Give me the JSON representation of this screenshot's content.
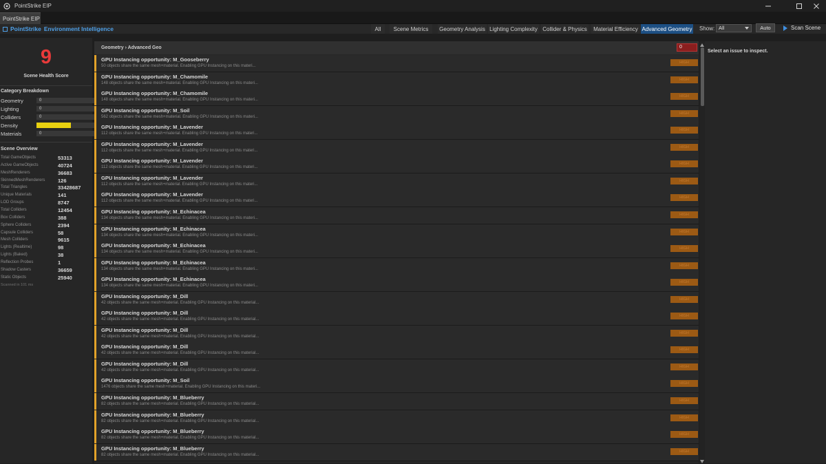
{
  "window": {
    "title": "PointStrike EIP"
  },
  "tab": {
    "label": "PointStrike EIP"
  },
  "brand": {
    "name": "PointStrike",
    "subtitle": "Environment Intelligence"
  },
  "nav": {
    "items": [
      "All",
      "Scene Metrics",
      "Geometry Analysis",
      "Lighting Complexity",
      "Collider & Physics",
      "Material Efficiency",
      "Advanced Geometry"
    ],
    "active": "Advanced Geometry",
    "show_label": "Show:",
    "show_value": "All",
    "auto_label": "Auto",
    "scan_label": "Scan Scene"
  },
  "health": {
    "score": "9",
    "label": "Scene Health Score",
    "score_color": "#e83a3a"
  },
  "category_breakdown": {
    "title": "Category Breakdown",
    "items": [
      {
        "label": "Geometry",
        "value": "0",
        "fill": 0
      },
      {
        "label": "Lighting",
        "value": "0",
        "fill": 0
      },
      {
        "label": "Colliders",
        "value": "0",
        "fill": 0
      },
      {
        "label": "Density",
        "value": "",
        "fill": 0.6
      },
      {
        "label": "Materials",
        "value": "0",
        "fill": 0
      }
    ],
    "fill_color": "#e8d010"
  },
  "overview": {
    "title": "Scene Overview",
    "rows": [
      {
        "k": "Total GameObjects",
        "v": "53313"
      },
      {
        "k": "Active GameObjects",
        "v": "40724"
      },
      {
        "k": "MeshRenderers",
        "v": "36683"
      },
      {
        "k": "SkinnedMeshRenderers",
        "v": "126"
      },
      {
        "k": "Total Triangles",
        "v": "33428687"
      },
      {
        "k": "Unique Materials",
        "v": "141"
      },
      {
        "k": "LOD Groups",
        "v": "8747"
      },
      {
        "k": "Total Colliders",
        "v": "12454"
      },
      {
        "k": "Box Colliders",
        "v": "388"
      },
      {
        "k": "Sphere Colliders",
        "v": "2394"
      },
      {
        "k": "Capsule Colliders",
        "v": "58"
      },
      {
        "k": "Mesh Colliders",
        "v": "9615"
      },
      {
        "k": "Lights (Realtime)",
        "v": "98"
      },
      {
        "k": "Lights (Baked)",
        "v": "38"
      },
      {
        "k": "Reflection Probes",
        "v": "1"
      },
      {
        "k": "Shadow Casters",
        "v": "36659"
      },
      {
        "k": "Static Objects",
        "v": "25940"
      }
    ],
    "scanned": "Scanned in 101 ms"
  },
  "list": {
    "breadcrumb": "Geometry  ›  Advanced Geo",
    "count": "0",
    "severity_color": "#9c5a14",
    "accent_color": "#e2a22a",
    "issues": [
      {
        "title": "GPU Instancing opportunity: M_Gooseberry",
        "desc": "50 objects share the same mesh+material. Enabling GPU Instancing on this materi...",
        "sev": "HIGH"
      },
      {
        "title": "GPU Instancing opportunity: M_Chamomile",
        "desc": "148 objects share the same mesh+material. Enabling GPU Instancing on this materi...",
        "sev": "HIGH"
      },
      {
        "title": "GPU Instancing opportunity: M_Chamomile",
        "desc": "148 objects share the same mesh+material. Enabling GPU Instancing on this materi...",
        "sev": "HIGH"
      },
      {
        "title": "GPU Instancing opportunity: M_Soil",
        "desc": "562 objects share the same mesh+material. Enabling GPU Instancing on this materi...",
        "sev": "HIGH"
      },
      {
        "title": "GPU Instancing opportunity: M_Lavender",
        "desc": "112 objects share the same mesh+material. Enabling GPU Instancing on this materi...",
        "sev": "HIGH"
      },
      {
        "title": "GPU Instancing opportunity: M_Lavender",
        "desc": "112 objects share the same mesh+material. Enabling GPU Instancing on this materi...",
        "sev": "HIGH"
      },
      {
        "title": "GPU Instancing opportunity: M_Lavender",
        "desc": "112 objects share the same mesh+material. Enabling GPU Instancing on this materi...",
        "sev": "HIGH"
      },
      {
        "title": "GPU Instancing opportunity: M_Lavender",
        "desc": "112 objects share the same mesh+material. Enabling GPU Instancing on this materi...",
        "sev": "HIGH"
      },
      {
        "title": "GPU Instancing opportunity: M_Lavender",
        "desc": "112 objects share the same mesh+material. Enabling GPU Instancing on this materi...",
        "sev": "HIGH"
      },
      {
        "title": "GPU Instancing opportunity: M_Echinacea",
        "desc": "134 objects share the same mesh+material. Enabling GPU Instancing on this materi...",
        "sev": "HIGH"
      },
      {
        "title": "GPU Instancing opportunity: M_Echinacea",
        "desc": "134 objects share the same mesh+material. Enabling GPU Instancing on this materi...",
        "sev": "HIGH"
      },
      {
        "title": "GPU Instancing opportunity: M_Echinacea",
        "desc": "134 objects share the same mesh+material. Enabling GPU Instancing on this materi...",
        "sev": "HIGH"
      },
      {
        "title": "GPU Instancing opportunity: M_Echinacea",
        "desc": "134 objects share the same mesh+material. Enabling GPU Instancing on this materi...",
        "sev": "HIGH"
      },
      {
        "title": "GPU Instancing opportunity: M_Echinacea",
        "desc": "134 objects share the same mesh+material. Enabling GPU Instancing on this materi...",
        "sev": "HIGH"
      },
      {
        "title": "GPU Instancing opportunity: M_Dill",
        "desc": "42 objects share the same mesh+material. Enabling GPU Instancing on this material...",
        "sev": "HIGH"
      },
      {
        "title": "GPU Instancing opportunity: M_Dill",
        "desc": "42 objects share the same mesh+material. Enabling GPU Instancing on this material...",
        "sev": "HIGH"
      },
      {
        "title": "GPU Instancing opportunity: M_Dill",
        "desc": "42 objects share the same mesh+material. Enabling GPU Instancing on this material...",
        "sev": "HIGH"
      },
      {
        "title": "GPU Instancing opportunity: M_Dill",
        "desc": "42 objects share the same mesh+material. Enabling GPU Instancing on this material...",
        "sev": "HIGH"
      },
      {
        "title": "GPU Instancing opportunity: M_Dill",
        "desc": "42 objects share the same mesh+material. Enabling GPU Instancing on this material...",
        "sev": "HIGH"
      },
      {
        "title": "GPU Instancing opportunity: M_Soil",
        "desc": "1476 objects share the same mesh+material. Enabling GPU Instancing on this materi...",
        "sev": "HIGH"
      },
      {
        "title": "GPU Instancing opportunity: M_Blueberry",
        "desc": "82 objects share the same mesh+material. Enabling GPU Instancing on this material...",
        "sev": "HIGH"
      },
      {
        "title": "GPU Instancing opportunity: M_Blueberry",
        "desc": "82 objects share the same mesh+material. Enabling GPU Instancing on this material...",
        "sev": "HIGH"
      },
      {
        "title": "GPU Instancing opportunity: M_Blueberry",
        "desc": "82 objects share the same mesh+material. Enabling GPU Instancing on this material...",
        "sev": "HIGH"
      },
      {
        "title": "GPU Instancing opportunity: M_Blueberry",
        "desc": "82 objects share the same mesh+material. Enabling GPU Instancing on this material...",
        "sev": "HIGH"
      }
    ]
  },
  "inspector": {
    "hint": "Select an issue to inspect."
  }
}
